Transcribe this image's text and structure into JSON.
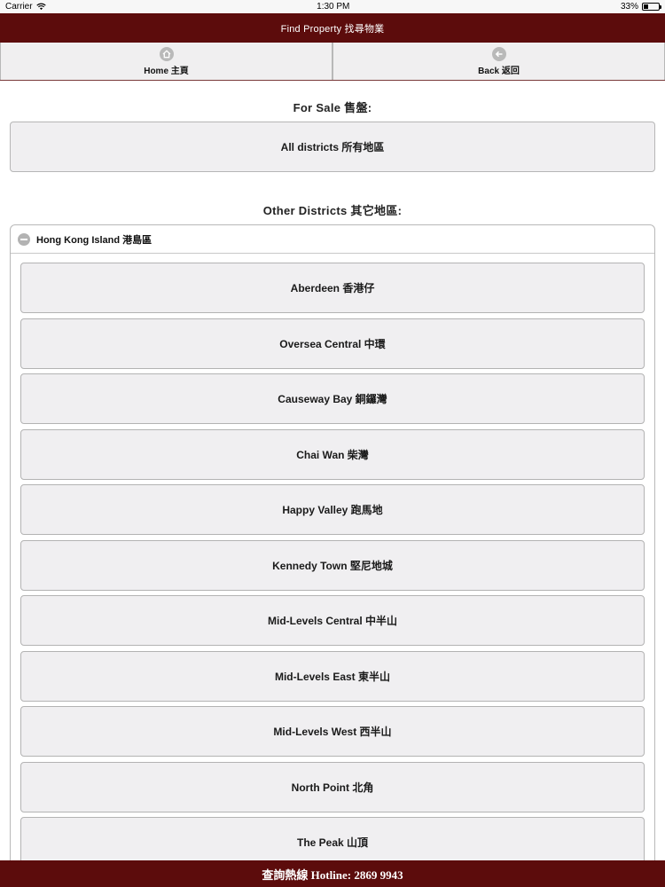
{
  "status_bar": {
    "carrier": "Carrier",
    "time": "1:30 PM",
    "battery": "33%",
    "battery_level": 0.33
  },
  "header": {
    "title": "Find Property 找尋物業"
  },
  "nav": {
    "home_label": "Home 主頁",
    "back_label": "Back 返回",
    "home_icon": "home-icon",
    "back_icon": "back-arrow-icon"
  },
  "for_sale": {
    "title": "For Sale 售盤:",
    "all_districts_label": "All districts 所有地區"
  },
  "other_districts": {
    "title": "Other Districts 其它地區:",
    "region_label": "Hong Kong Island 港島區",
    "region_icon": "collapse-minus-icon",
    "districts": [
      "Aberdeen 香港仔",
      "Oversea Central 中環",
      "Causeway Bay 銅鑼灣",
      "Chai Wan 柴灣",
      "Happy Valley 跑馬地",
      "Kennedy Town 堅尼地城",
      "Mid-Levels Central 中半山",
      "Mid-Levels East 東半山",
      "Mid-Levels West 西半山",
      "North Point 北角",
      "The Peak 山頂"
    ]
  },
  "footer": {
    "hotline": "查詢熱線 Hotline: 2869 9943"
  },
  "colors": {
    "brand": "#5c0c0c",
    "button_bg": "#f0eff1",
    "border": "#b6b6b6"
  }
}
